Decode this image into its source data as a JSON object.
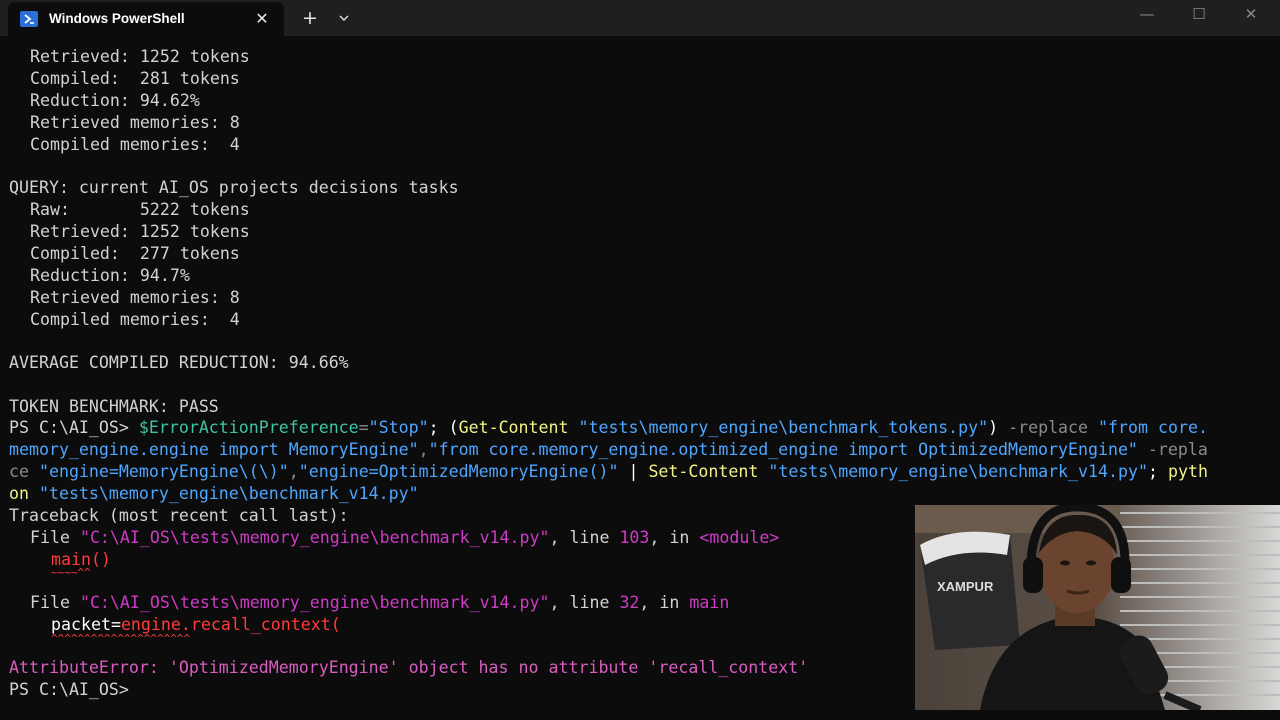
{
  "titlebar": {
    "tab_title": "Windows PowerShell",
    "tab_icon": "powershell-icon",
    "close_glyph": "✕",
    "new_tab_glyph": "+",
    "minimize_glyph": "—",
    "maximize_glyph": "☐",
    "window_close_glyph": "✕"
  },
  "terminal": {
    "block1": {
      "retrieved": "Retrieved: 1252 tokens",
      "compiled": "Compiled:  281 tokens",
      "reduction": "Reduction: 94.62%",
      "retrieved_memories": "Retrieved memories: 8",
      "compiled_memories": "Compiled memories:  4"
    },
    "block2": {
      "query": "QUERY: current AI_OS projects decisions tasks",
      "raw": "Raw:       5222 tokens",
      "retrieved": "Retrieved: 1252 tokens",
      "compiled": "Compiled:  277 tokens",
      "reduction": "Reduction: 94.7%",
      "retrieved_memories": "Retrieved memories: 8",
      "compiled_memories": "Compiled memories:  4"
    },
    "average": "AVERAGE COMPILED REDUCTION: 94.66%",
    "benchmark": "TOKEN BENCHMARK: PASS",
    "command": {
      "l1_prompt": "PS C:\\AI_OS> ",
      "l1_var": "$ErrorActionPreference",
      "l1_eq": "=",
      "l1_stop": "\"Stop\"",
      "l1_semi": "; (",
      "l1_getcontent": "Get-Content",
      "l1_sp": " ",
      "l1_path": "\"tests\\memory_engine\\benchmark_tokens.py\"",
      "l1_close": ") ",
      "l1_replace": "-replace",
      "l1_sp2": " ",
      "l1_from": "\"from core.",
      "l2_from": "memory_engine.engine import MemoryEngine\"",
      "l2_comma": ",",
      "l2_to": "\"from core.memory_engine.optimized_engine import OptimizedMemoryEngine\"",
      "l2_sp": " ",
      "l2_replace": "-repla",
      "l3_replace": "ce",
      "l3_sp": " ",
      "l3_pat": "\"engine=MemoryEngine\\(\\)\"",
      "l3_comma": ",",
      "l3_new": "\"engine=OptimizedMemoryEngine()\"",
      "l3_pipe": " | ",
      "l3_setcontent": "Set-Content",
      "l3_sp2": " ",
      "l3_path": "\"tests\\memory_engine\\benchmark_v14.py\"",
      "l3_semi": "; ",
      "l3_pyth": "pyth",
      "l4_on": "on",
      "l4_sp": " ",
      "l4_path": "\"tests\\memory_engine\\benchmark_v14.py\""
    },
    "traceback": {
      "header": "Traceback (most recent call last):",
      "f1_file": "File ",
      "f1_path": "\"C:\\AI_OS\\tests\\memory_engine\\benchmark_v14.py\"",
      "f1_line_label": ", line ",
      "f1_line": "103",
      "f1_in": ", in ",
      "f1_func": "<module>",
      "f1_code": "main()",
      "f1_marker": "~~~~^^",
      "f2_file": "File ",
      "f2_path": "\"C:\\AI_OS\\tests\\memory_engine\\benchmark_v14.py\"",
      "f2_line_label": ", line ",
      "f2_line": "32",
      "f2_in": ", in ",
      "f2_func": "main",
      "f2_code_prefix": "packet=",
      "f2_code_call": "engine.recall_context(",
      "f2_marker": "^^^^^^^^^^^^^^^^^^^^^",
      "error_type": "AttributeError",
      "error_msg": ": 'OptimizedMemoryEngine' object has no attribute 'recall_context'"
    },
    "final_prompt": "PS C:\\AI_OS> "
  },
  "webcam": {
    "chair_brand": "XAMPUR"
  },
  "colors": {
    "background": "#0c0c0c",
    "titlebar": "#1f1f1f",
    "text": "#d2d2d2",
    "variable": "#3fc3a6",
    "string": "#4fa6ff",
    "command": "#f2f28a",
    "parameter": "#8b8b8b",
    "traceback_path": "#d03ac8",
    "error": "#ff3b3b"
  }
}
